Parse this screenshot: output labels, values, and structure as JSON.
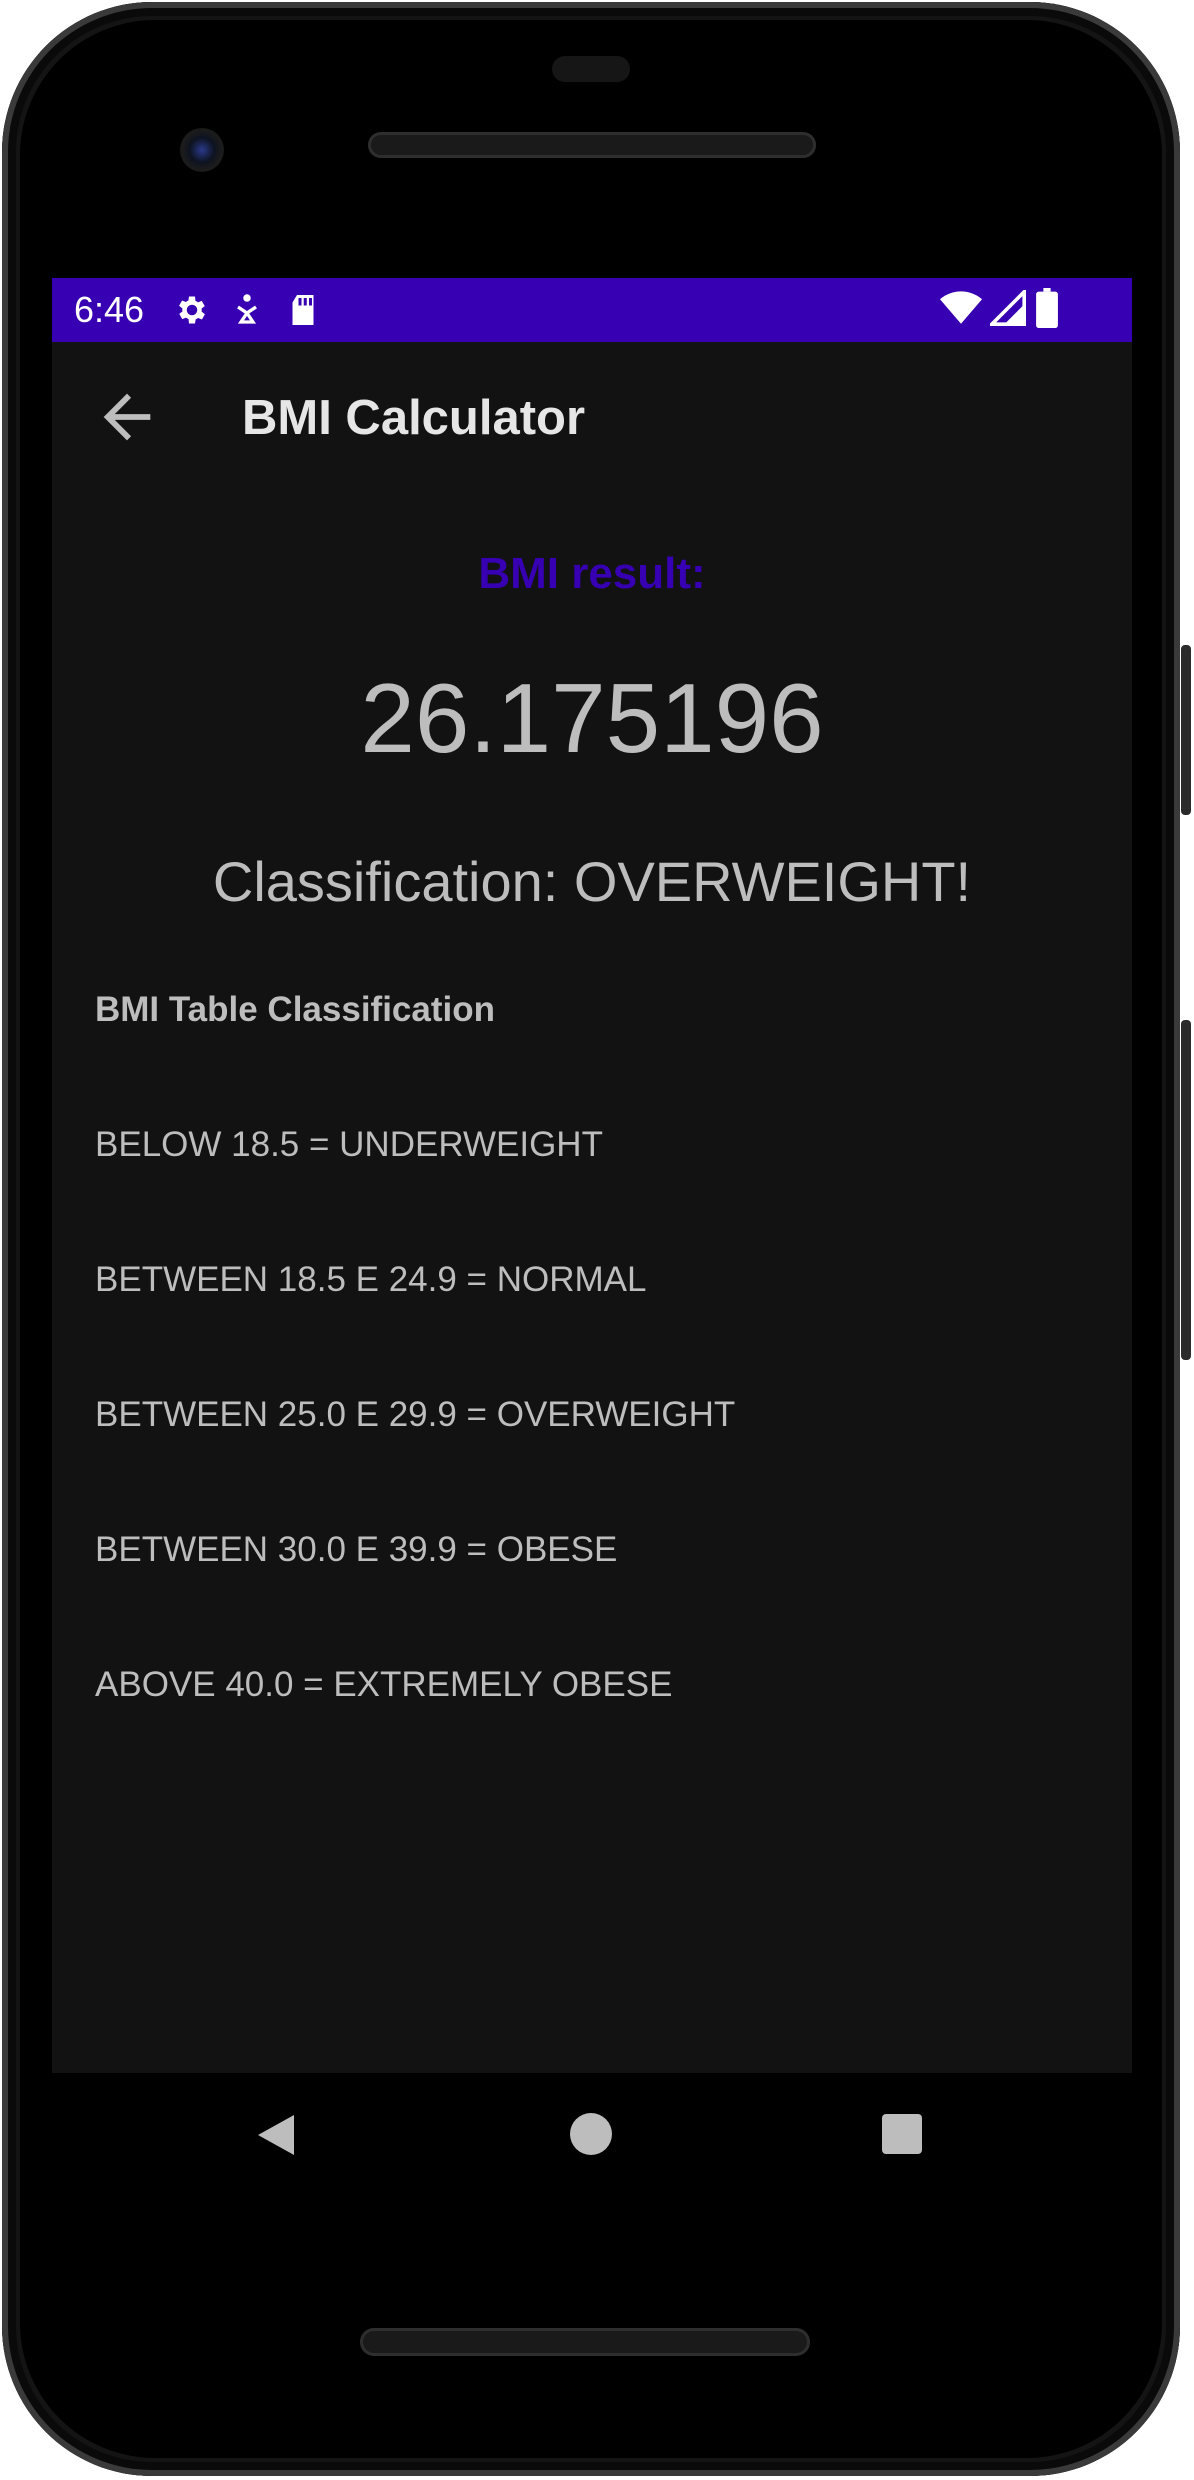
{
  "status_bar": {
    "time": "6:46",
    "background_color": "#3700b3",
    "left_icons": [
      "settings-icon",
      "accessibility-icon",
      "sd-card-icon"
    ],
    "right_icons": [
      "wifi-icon",
      "cell-signal-icon",
      "battery-icon"
    ]
  },
  "app_bar": {
    "title": "BMI Calculator",
    "back_icon": "arrow-back-icon"
  },
  "result": {
    "label": "BMI result:",
    "label_color": "#3700b3",
    "value": "26.175196",
    "classification": "Classification: OVERWEIGHT!"
  },
  "bmi_table": {
    "title": "BMI Table Classification",
    "rows": [
      "BELOW 18.5 = UNDERWEIGHT",
      "BETWEEN 18.5 E 24.9 = NORMAL",
      "BETWEEN 25.0 E 29.9 = OVERWEIGHT",
      "BETWEEN 30.0 E 39.9 = OBESE",
      "ABOVE 40.0 = EXTREMELY OBESE"
    ]
  },
  "nav_bar": {
    "buttons": [
      "back-triangle-icon",
      "home-circle-icon",
      "recents-square-icon"
    ]
  }
}
